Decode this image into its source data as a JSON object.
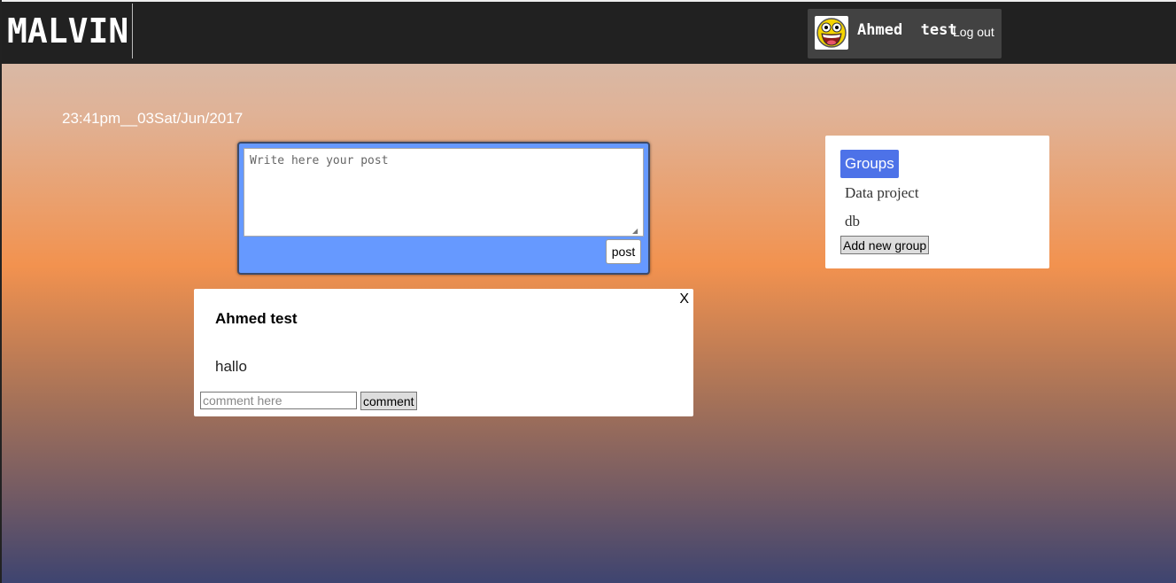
{
  "header": {
    "logo": "MALVIN",
    "user_name": "Ahmed  test",
    "logout_label": "Log out",
    "avatar_icon": "smiley-face-icon"
  },
  "clock": "23:41pm__03Sat/Jun/2017",
  "composer": {
    "placeholder": "Write here your post",
    "post_label": "post"
  },
  "post": {
    "close_label": "X",
    "author": "Ahmed test",
    "body": "hallo",
    "comment_placeholder": "comment here",
    "comment_label": "comment"
  },
  "groups": {
    "title": "Groups",
    "items": [
      "Data project",
      "db"
    ],
    "add_label": "Add new group"
  }
}
